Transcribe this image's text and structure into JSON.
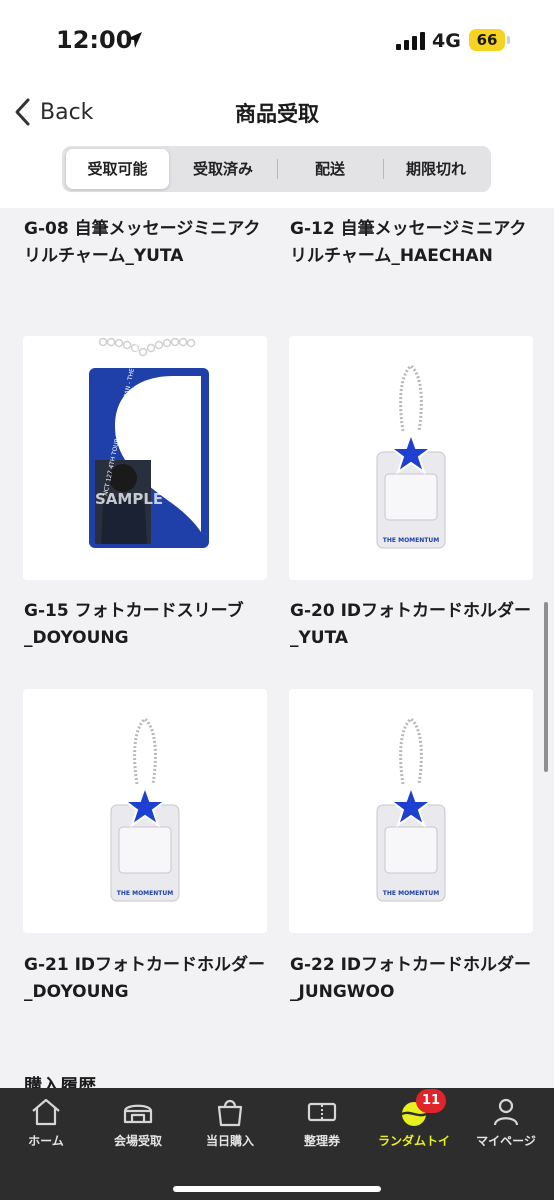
{
  "status_bar": {
    "time": "12:00",
    "network": "4G",
    "battery": "66"
  },
  "nav": {
    "back_label": "Back",
    "title": "商品受取"
  },
  "segments": [
    "受取可能",
    "受取済み",
    "配送",
    "期限切れ"
  ],
  "products": [
    {
      "name": "G-08 自筆メッセージミニアクリルチャーム_YUTA"
    },
    {
      "name": "G-12 自筆メッセージミニアクリルチャーム_HAECHAN"
    },
    {
      "name": "G-15 フォトカードスリーブ_DOYOUNG",
      "image_text": "SAMPLE",
      "logo_text": "THE MOMENTUM",
      "side_text": "NCT 127 4TH TOUR NEO CITY - JAPAN - THE MOMENTUM"
    },
    {
      "name": "G-20 IDフォトカードホルダー_YUTA",
      "logo_text": "THE MOMENTUM"
    },
    {
      "name": "G-21 IDフォトカードホルダー_DOYOUNG",
      "logo_text": "THE MOMENTUM"
    },
    {
      "name": "G-22 IDフォトカードホルダー_JUNGWOO",
      "logo_text": "THE MOMENTUM"
    }
  ],
  "section_title": "購入履歴",
  "tabs": [
    {
      "label": "ホーム",
      "icon": "home-icon"
    },
    {
      "label": "会場受取",
      "icon": "venue-icon"
    },
    {
      "label": "当日購入",
      "icon": "shopping-bag-icon"
    },
    {
      "label": "整理券",
      "icon": "ticket-icon"
    },
    {
      "label": "ランダムトイ",
      "icon": "random-toy-icon",
      "badge": "11"
    },
    {
      "label": "マイページ",
      "icon": "person-icon"
    }
  ],
  "colors": {
    "accent_yellow": "#e8f020",
    "badge_red": "#e0242b",
    "tabbar_bg": "#2d2d2d",
    "merch_blue": "#1e40a8"
  }
}
